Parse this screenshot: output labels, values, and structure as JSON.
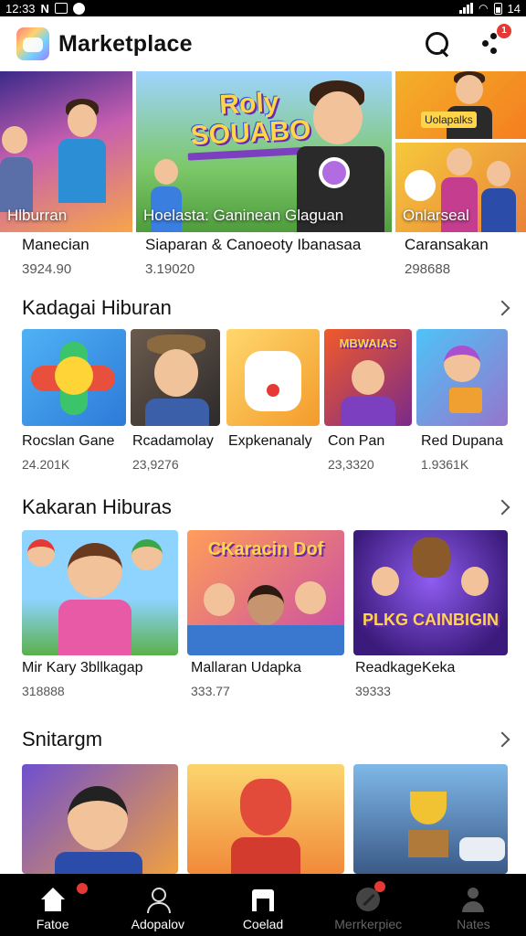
{
  "status_bar": {
    "time": "12:33",
    "left_letter": "N",
    "battery": "14"
  },
  "app": {
    "title": "Marketplace",
    "notification_count": "1"
  },
  "hero": {
    "tiles": [
      {
        "label": "Hlburran"
      },
      {
        "label": "Hoelasta: Ganinean Glaguan",
        "logo_line1": "Roly",
        "logo_line2": "SOUABO"
      },
      {
        "label": "Uolapalks"
      },
      {
        "label": "Onlarseal"
      }
    ],
    "captions": [
      {
        "title": "Manecian",
        "count": "3924.90"
      },
      {
        "title": "Siaparan & Canoeoty Ibanasaa",
        "count": "3.19020"
      },
      {
        "title": "Caransakan",
        "count": "298688"
      }
    ]
  },
  "sections": [
    {
      "title": "Kadagai Hiburan",
      "items": [
        {
          "title": "Rocslan Gane",
          "count": "24.201K"
        },
        {
          "title": "Rcadamolay",
          "count": "23,9276"
        },
        {
          "title": "Expkenanaly",
          "count": ""
        },
        {
          "title": "Con Pan",
          "count": "23,3320",
          "art_text": "MBWAIAS"
        },
        {
          "title": "Red Dupana",
          "count": "1.9361K"
        }
      ]
    },
    {
      "title": "Kakaran Hiburas",
      "items": [
        {
          "title": "Mir Kary 3bllkagap",
          "count": "318888"
        },
        {
          "title": "Mallaran Udapka",
          "count": "333.77",
          "art_text": "CKaracin Dof"
        },
        {
          "title": "ReadkageKeka",
          "count": "39333",
          "art_text": "PLKG CAINBIGIN"
        }
      ]
    },
    {
      "title": "Snitargm",
      "items": [
        {},
        {},
        {}
      ]
    }
  ],
  "bottom_nav": [
    {
      "label": "Fatoe",
      "icon": "home-icon",
      "active": true
    },
    {
      "label": "Adopalov",
      "icon": "user-icon",
      "active": true
    },
    {
      "label": "Coelad",
      "icon": "store-icon",
      "active": true
    },
    {
      "label": "Merrkerpiec",
      "icon": "compass-icon",
      "active": false
    },
    {
      "label": "Nates",
      "icon": "profile-icon",
      "active": false
    }
  ],
  "colors": {
    "accent": "#e53935",
    "nav_bg": "#000000"
  }
}
